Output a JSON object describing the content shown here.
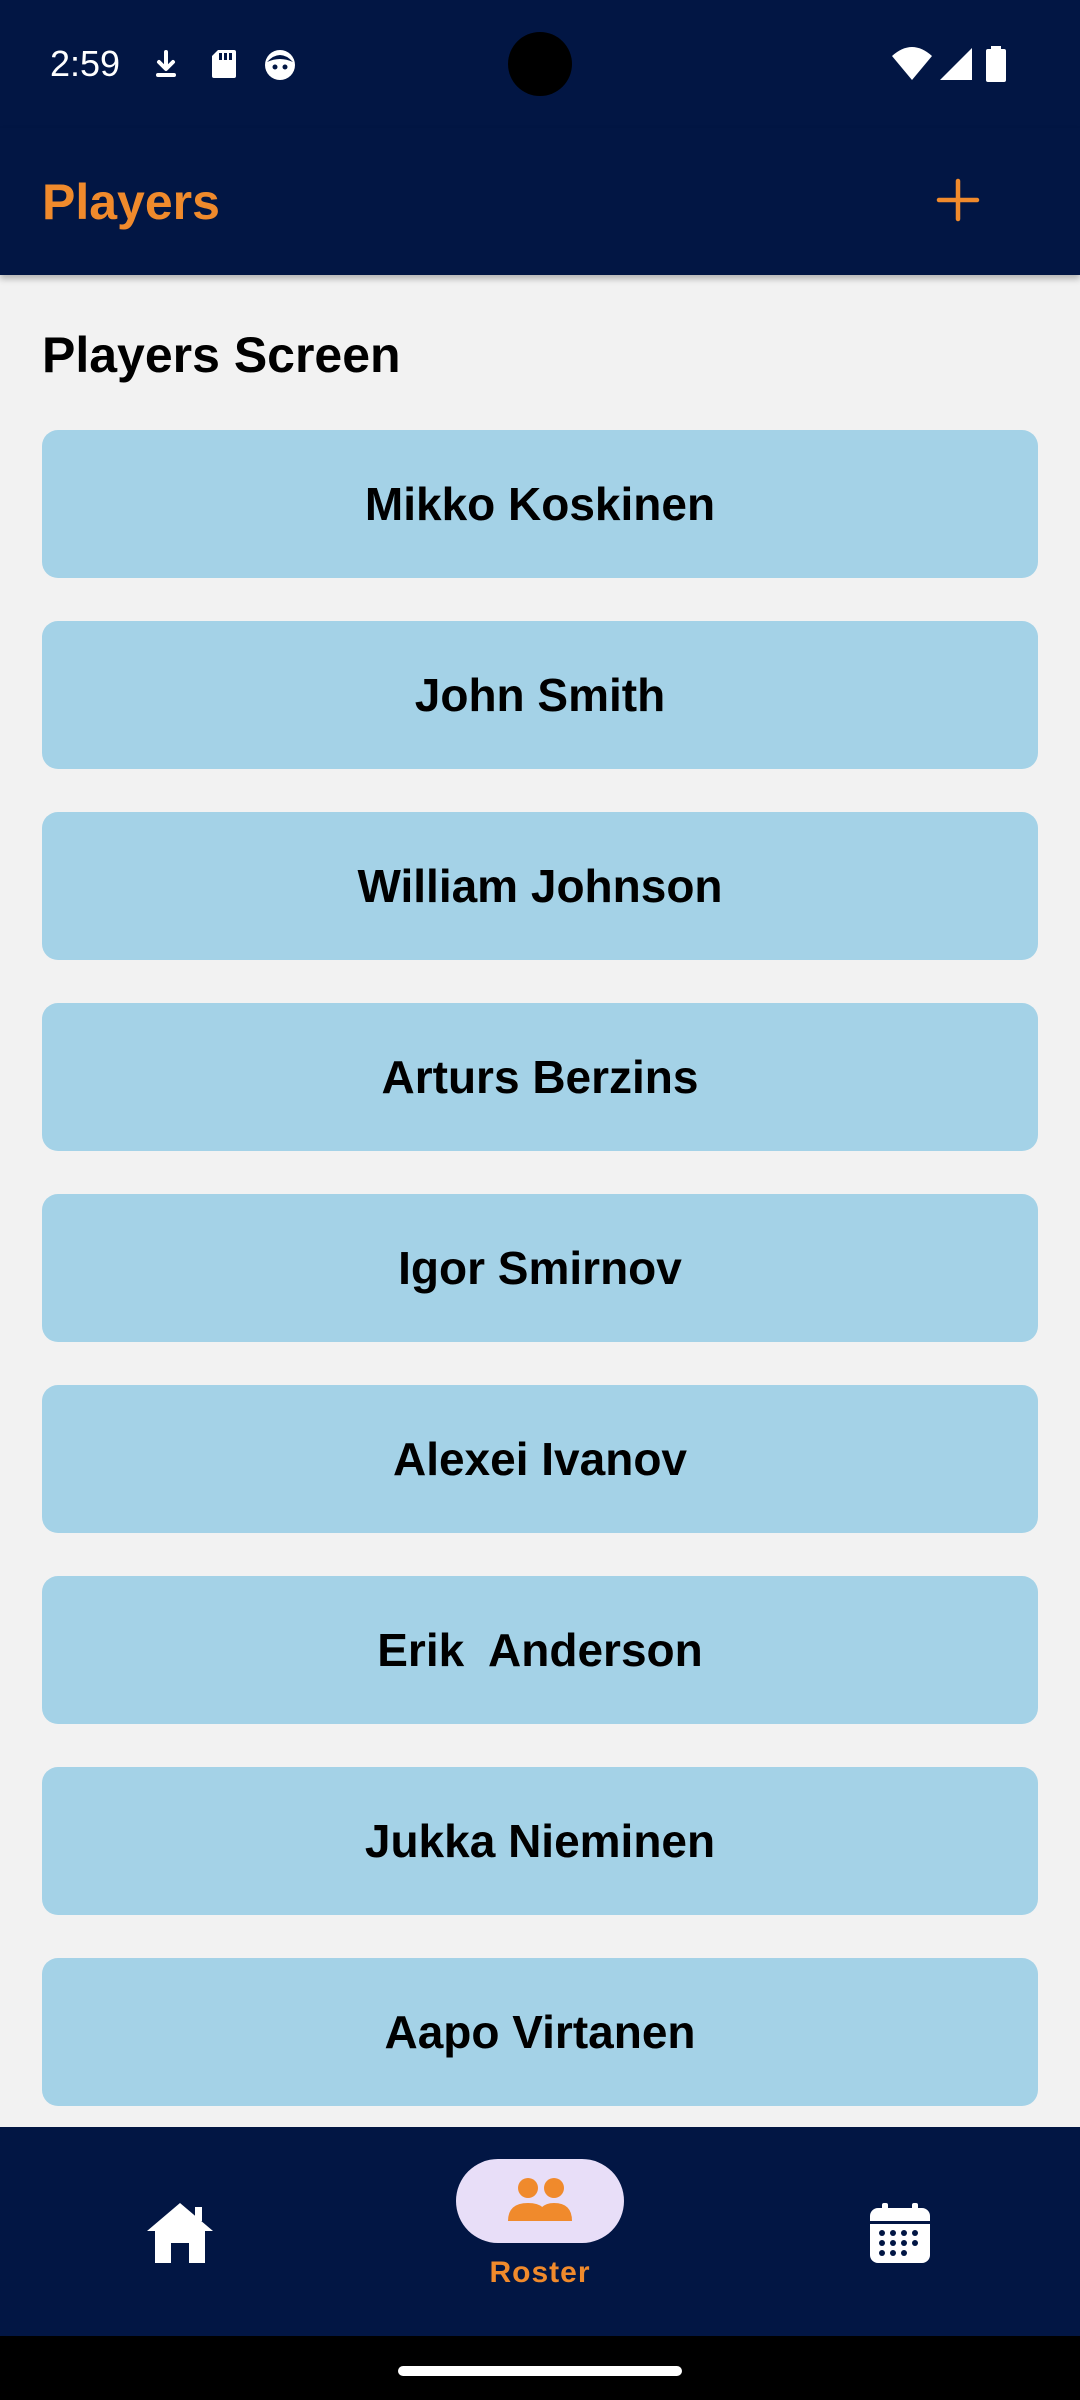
{
  "status_bar": {
    "time": "2:59",
    "icons": [
      "download-icon",
      "sd-card-icon",
      "face-icon",
      "wifi-icon",
      "signal-icon",
      "battery-icon"
    ]
  },
  "app_bar": {
    "title": "Players",
    "add_icon": "plus-icon"
  },
  "screen": {
    "title": "Players Screen"
  },
  "players": [
    "Mikko Koskinen",
    "John Smith",
    "William Johnson",
    "Arturs Berzins",
    "Igor Smirnov",
    "Alexei Ivanov",
    "Erik  Anderson",
    "Jukka Nieminen",
    "Aapo Virtanen"
  ],
  "bottom_nav": {
    "items": [
      {
        "icon": "home-icon",
        "label": "",
        "selected": false
      },
      {
        "icon": "people-icon",
        "label": "Roster",
        "selected": true
      },
      {
        "icon": "calendar-icon",
        "label": "",
        "selected": false
      }
    ]
  },
  "colors": {
    "primary_dark": "#021644",
    "accent": "#F08A2C",
    "player_button": "#A4D2E7",
    "background": "#F2F2F2",
    "selected_pill": "#E8DEF8"
  }
}
